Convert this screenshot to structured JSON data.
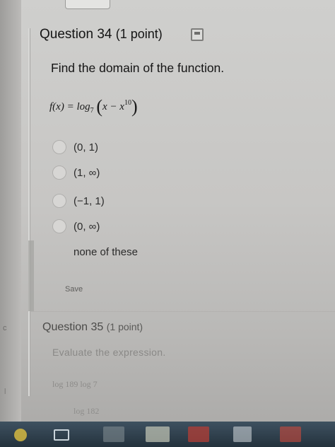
{
  "question": {
    "title": "Question 34",
    "points": "(1 point)",
    "prompt": "Find the domain of the function.",
    "formula": {
      "lhs": "f(x) = log",
      "base": "7",
      "inner": "x − x",
      "exponent": "10"
    },
    "options": [
      {
        "label": "(0, 1)"
      },
      {
        "label": "(1, ∞)"
      },
      {
        "label": "(−1, 1)"
      },
      {
        "label": "(0, ∞)"
      },
      {
        "label": "none of these"
      }
    ],
    "save_label": "Save"
  },
  "next_question": {
    "title": "Question 35",
    "points": "(1 point)",
    "prompt": "Evaluate the expression.",
    "expr1": "log   189   log   7",
    "expr2": "log   182"
  },
  "side": {
    "letter_top": "c",
    "letter_bottom": "l"
  },
  "colors": {
    "background": "#c7c6c4",
    "taskbar": "#2f3f4b"
  },
  "icons": [
    "save-icon",
    "radio-button",
    "taskbar-task-view-icon"
  ]
}
